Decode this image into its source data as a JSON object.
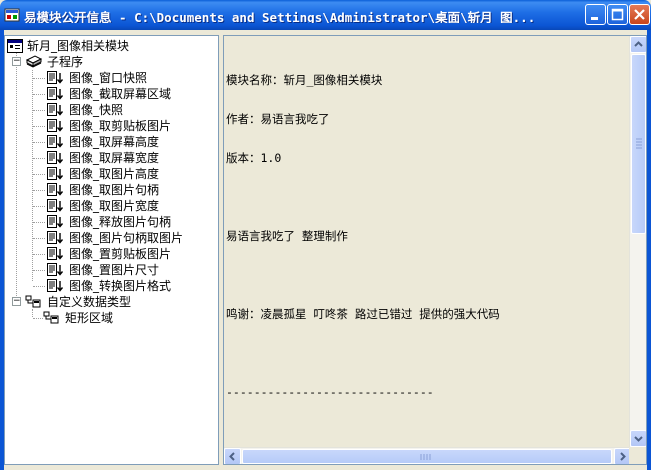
{
  "window": {
    "title": "易模块公开信息 - C:\\Documents and Settings\\Administrator\\桌面\\斩月_图..."
  },
  "tree": {
    "root": "斩月_图像相关模块",
    "group1": "子程序",
    "items": [
      "图像_窗口快照",
      "图像_截取屏幕区域",
      "图像_快照",
      "图像_取剪贴板图片",
      "图像_取屏幕高度",
      "图像_取屏幕宽度",
      "图像_取图片高度",
      "图像_取图片句柄",
      "图像_取图片宽度",
      "图像_释放图片句柄",
      "图像_图片句柄取图片",
      "图像_置剪贴板图片",
      "图像_置图片尺寸",
      "图像_转换图片格式"
    ],
    "group2": "自定义数据类型",
    "group2_items": [
      "矩形区域"
    ]
  },
  "content": {
    "line1": "模块名称：斩月_图像相关模块",
    "line2": "作者：易语言我吃了",
    "line3": "版本：1.0",
    "line4": "易语言我吃了 整理制作",
    "line5": "鸣谢：凌晨孤星 叮咚茶 路过已错过 提供的强大代码",
    "line6": "------------------------------"
  }
}
